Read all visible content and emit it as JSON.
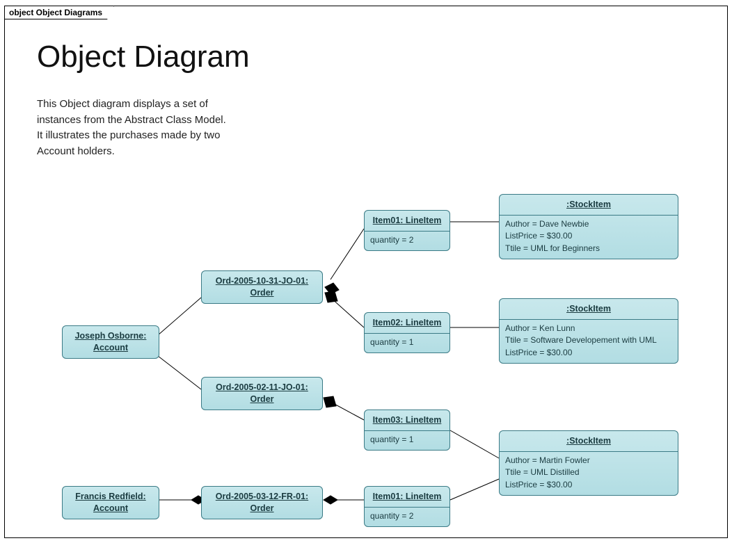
{
  "frameLabel": "object Object Diagrams",
  "title": "Object Diagram",
  "description": "This Object diagram displays a set of\ninstances from the Abstract Class Model.\nIt illustrates the purchases made by two\nAccount holders.",
  "objects": {
    "account1": {
      "header": "Joseph Osborne: Account"
    },
    "account2": {
      "header": "Francis Redfield: Account"
    },
    "order1": {
      "header": "Ord-2005-10-31-JO-01: Order"
    },
    "order2": {
      "header": "Ord-2005-02-11-JO-01: Order"
    },
    "order3": {
      "header": "Ord-2005-03-12-FR-01: Order"
    },
    "item01": {
      "header": "Item01: LineItem",
      "attr": "quantity = 2"
    },
    "item02": {
      "header": "Item02: LineItem",
      "attr": "quantity = 1"
    },
    "item03": {
      "header": "Item03: LineItem",
      "attr": "quantity = 1"
    },
    "item04": {
      "header": "Item01: LineItem",
      "attr": "quantity = 2"
    },
    "stock1": {
      "header": ":StockItem",
      "a1": "Author = Dave Newbie",
      "a2": "ListPrice = $30.00",
      "a3": "Ttile = UML for Beginners"
    },
    "stock2": {
      "header": ":StockItem",
      "a1": "Author = Ken Lunn",
      "a2": "Ttile = Software Developement with UML",
      "a3": "ListPrice = $30.00"
    },
    "stock3": {
      "header": ":StockItem",
      "a1": "Author = Martin Fowler",
      "a2": "Ttile = UML Distilled",
      "a3": "ListPrice = $30.00"
    }
  }
}
